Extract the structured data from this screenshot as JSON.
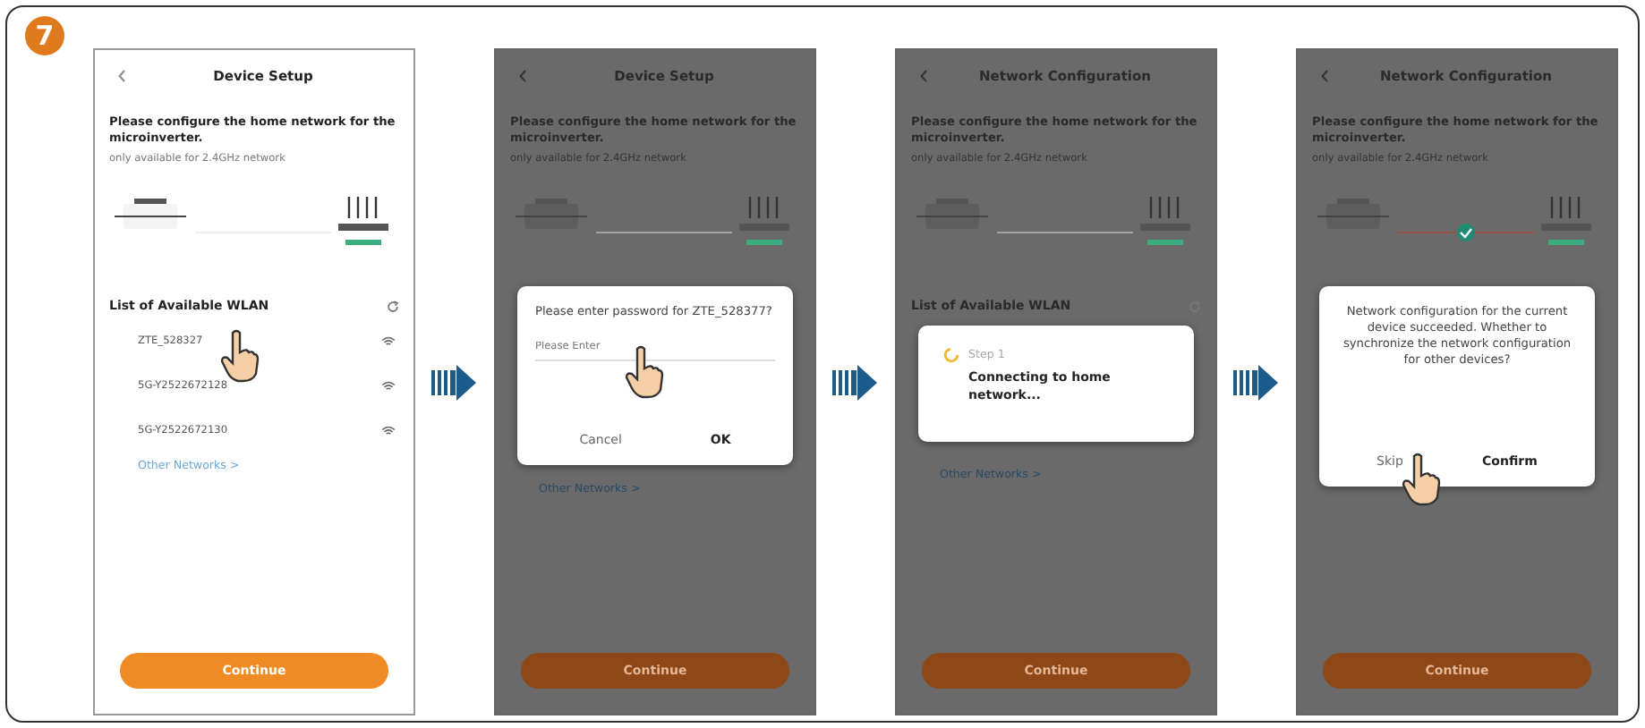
{
  "step_badge": "7",
  "panels": [
    {
      "title": "Device Setup",
      "dimmed": false,
      "instruction": "Please configure the home network for the microinverter.",
      "note": "only available for 2.4GHz network",
      "connected": false,
      "list_heading": "List of Available WLAN",
      "networks": [
        {
          "name": "ZTE_528327",
          "tapped": true
        },
        {
          "name": "5G-Y2522672128",
          "tapped": false
        },
        {
          "name": "5G-Y2522672130",
          "tapped": false
        }
      ],
      "other_networks": "Other Networks >",
      "continue": "Continue"
    },
    {
      "title": "Device Setup",
      "dimmed": true,
      "instruction": "Please configure the home network for the microinverter.",
      "note": "only available for 2.4GHz network",
      "connected": false,
      "other_networks": "Other Networks >",
      "continue": "Continue",
      "dialog": {
        "kind": "password",
        "message": "Please enter password for ZTE_528377?",
        "placeholder": "Please Enter",
        "field_tapped": true,
        "buttons": [
          {
            "label": "Cancel",
            "primary": false,
            "tapped": false
          },
          {
            "label": "OK",
            "primary": true,
            "tapped": false
          }
        ]
      }
    },
    {
      "title": "Network Configuration",
      "dimmed": true,
      "instruction": "Please configure the home network for the microinverter.",
      "note": "only available for 2.4GHz network",
      "connected": false,
      "list_heading": "List of Available WLAN",
      "other_networks": "Other Networks >",
      "continue": "Continue",
      "dialog": {
        "kind": "progress",
        "step": "Step 1",
        "message": "Connecting to home network..."
      }
    },
    {
      "title": "Network Configuration",
      "dimmed": true,
      "instruction": "Please configure the home network for the microinverter.",
      "note": "only available for 2.4GHz network",
      "connected": true,
      "continue": "Continue",
      "dialog": {
        "kind": "confirm",
        "message": "Network configuration for the current device succeeded. Whether to synchronize the network configuration for other devices?",
        "buttons": [
          {
            "label": "Skip",
            "primary": false,
            "tapped": true
          },
          {
            "label": "Confirm",
            "primary": true,
            "tapped": false
          }
        ]
      }
    }
  ]
}
